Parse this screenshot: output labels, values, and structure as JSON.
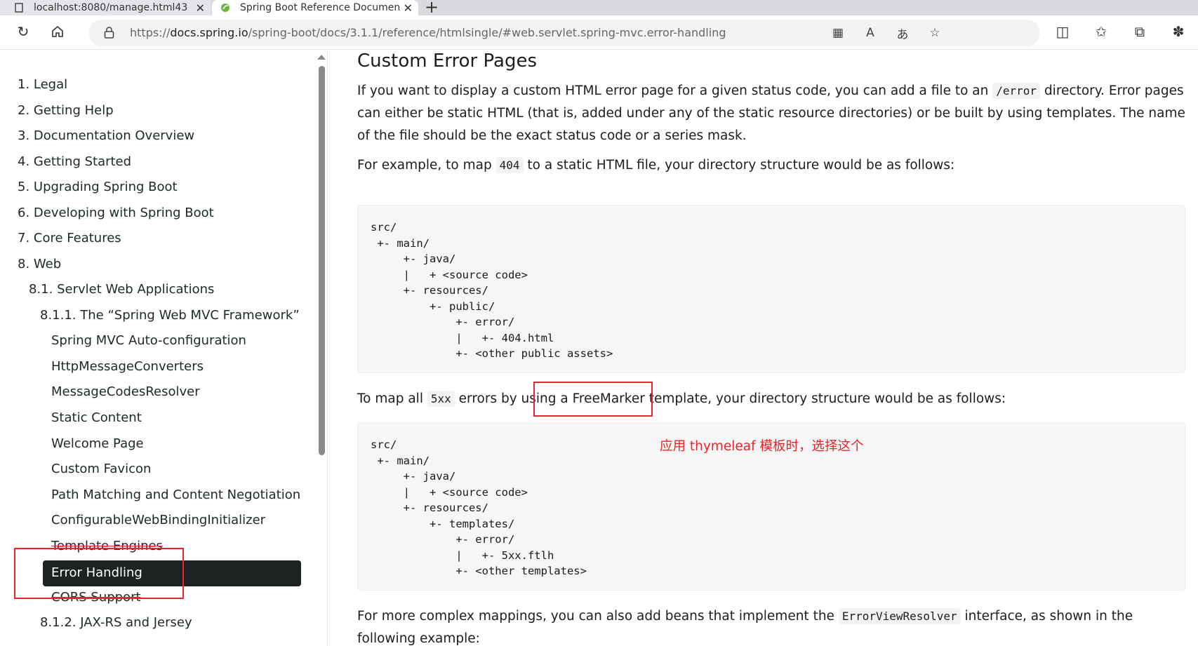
{
  "tabs": [
    {
      "title": "localhost:8080/manage.html43"
    },
    {
      "title": "Spring Boot Reference Documen"
    }
  ],
  "address": {
    "url_scheme": "https://",
    "url_host": "docs.spring.io",
    "url_path": "/spring-boot/docs/3.1.1/reference/htmlsingle/#web.servlet.spring-mvc.error-handling"
  },
  "toc": {
    "items": [
      "1. Legal",
      "2. Getting Help",
      "3. Documentation Overview",
      "4. Getting Started",
      "5. Upgrading Spring Boot",
      "6. Developing with Spring Boot",
      "7. Core Features",
      "8. Web",
      "8.1. Servlet Web Applications",
      "8.1.1. The “Spring Web MVC Framework”",
      "Spring MVC Auto-configuration",
      "HttpMessageConverters",
      "MessageCodesResolver",
      "Static Content",
      "Welcome Page",
      "Custom Favicon",
      "Path Matching and Content Negotiation",
      "ConfigurableWebBindingInitializer",
      "Template Engines",
      "Error Handling",
      "CORS Support",
      "8.1.2. JAX-RS and Jersey"
    ],
    "active": "Error Handling"
  },
  "content": {
    "heading": "Custom Error Pages",
    "p1_a": "If you want to display a custom HTML error page for a given status code, you can add a file to an",
    "p1_code": "/error",
    "p1_b": "directory. Error pages can either be static HTML (that is, added under any of the static resource directories) or be built by using templates. The name of the file should be the exact status code or a series mask.",
    "p2_a": "For example, to map",
    "p2_code": "404",
    "p2_b": "to a static HTML file, your directory structure would be as follows:",
    "code1": "src/\n +- main/\n     +- java/\n     |   + <source code>\n     +- resources/\n         +- public/\n             +- error/\n             |   +- 404.html\n             +- <other public assets>",
    "p3_a": "To map all",
    "p3_code": "5xx",
    "p3_b": "errors by using a FreeMarker template, your directory structure would be as follows:",
    "code2": "src/\n +- main/\n     +- java/\n     |   + <source code>\n     +- resources/\n         +- templates/\n             +- error/\n             |   +- 5xx.ftlh\n             +- <other templates>",
    "p4_a": "For more complex mappings, you can also add beans that implement the",
    "p4_code": "ErrorViewResolver",
    "p4_b": "interface, as shown in the following example:"
  },
  "annotation": {
    "note": "应用 thymeleaf 模板时，选择这个",
    "color": "#e8242a"
  }
}
